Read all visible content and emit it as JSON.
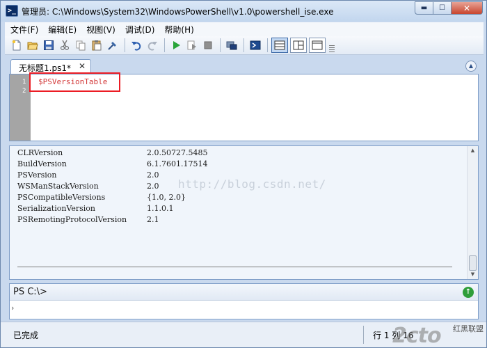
{
  "window": {
    "title": "管理员: C:\\Windows\\System32\\WindowsPowerShell\\v1.0\\powershell_ise.exe",
    "min_glyph": "▬",
    "max_glyph": "☐",
    "close_glyph": "✕"
  },
  "menu": [
    {
      "label": "文件(F)"
    },
    {
      "label": "编辑(E)"
    },
    {
      "label": "视图(V)"
    },
    {
      "label": "调试(D)"
    },
    {
      "label": "帮助(H)"
    }
  ],
  "toolbar": {
    "icons": [
      "new-icon",
      "open-icon",
      "save-icon",
      "cut-icon",
      "copy-icon",
      "paste-icon",
      "clear-icon",
      "undo-icon",
      "redo-icon",
      "run-icon",
      "run-selection-icon",
      "stop-icon",
      "remote-powershell-icon",
      "powershell-icon",
      "layout-top-icon",
      "layout-right-icon",
      "layout-max-icon"
    ]
  },
  "tabs": [
    {
      "label": "无标题1.ps1*",
      "close": "✕"
    }
  ],
  "script": {
    "line_numbers": [
      "1",
      "2"
    ],
    "lines": [
      "$PSVersionTable"
    ],
    "colors": {
      "code": "#d33a3a",
      "highlight_box": "#ec1c24"
    }
  },
  "output": {
    "rows": [
      {
        "key": "CLRVersion",
        "value": "2.0.50727.5485"
      },
      {
        "key": "BuildVersion",
        "value": "6.1.7601.17514"
      },
      {
        "key": "PSVersion",
        "value": "2.0"
      },
      {
        "key": "WSManStackVersion",
        "value": "2.0"
      },
      {
        "key": "PSCompatibleVersions",
        "value": "{1.0, 2.0}"
      },
      {
        "key": "SerializationVersion",
        "value": "1.1.0.1"
      },
      {
        "key": "PSRemotingProtocolVersion",
        "value": "2.1"
      }
    ],
    "watermark": "http://blog.csdn.net/"
  },
  "command": {
    "prompt": "PS C:\\>",
    "caret": "›"
  },
  "status": {
    "text": "已完成",
    "position": "行 1 列 16",
    "brand_logo": "2cto",
    "brand_tag": "红黑联盟"
  }
}
